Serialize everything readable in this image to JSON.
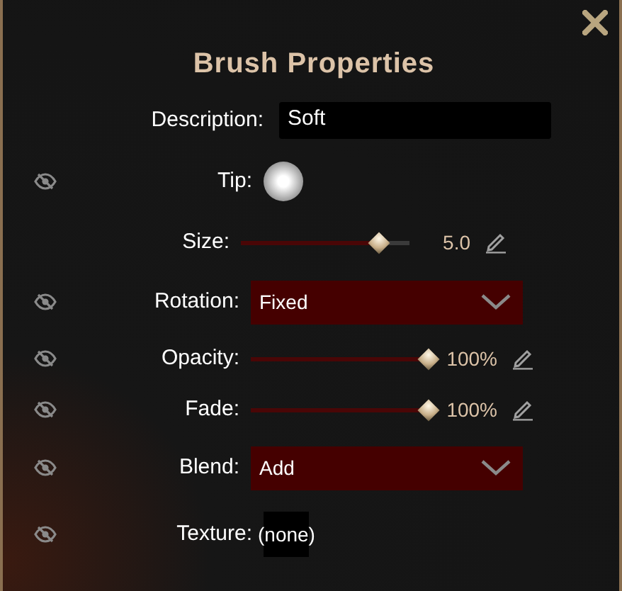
{
  "window": {
    "title": "Brush Properties"
  },
  "rows": [
    {
      "kind": "text",
      "label": "Description:",
      "value": "Soft",
      "hideable": false
    },
    {
      "kind": "tip",
      "label": "Tip:",
      "hideable": true
    },
    {
      "kind": "slider",
      "label": "Size:",
      "level": 0.82,
      "reading": "5.0",
      "hideable": false
    },
    {
      "kind": "dropdown",
      "label": "Rotation:",
      "value": "Fixed",
      "hideable": true
    },
    {
      "kind": "slider",
      "label": "Opacity:",
      "level": 1.0,
      "reading": "100%",
      "hideable": true
    },
    {
      "kind": "slider",
      "label": "Fade:",
      "level": 1.0,
      "reading": "100%",
      "hideable": true
    },
    {
      "kind": "dropdown",
      "label": "Blend:",
      "value": "Add",
      "hideable": true
    },
    {
      "kind": "texture",
      "label": "Texture:",
      "value": "(none)",
      "hideable": true
    }
  ]
}
